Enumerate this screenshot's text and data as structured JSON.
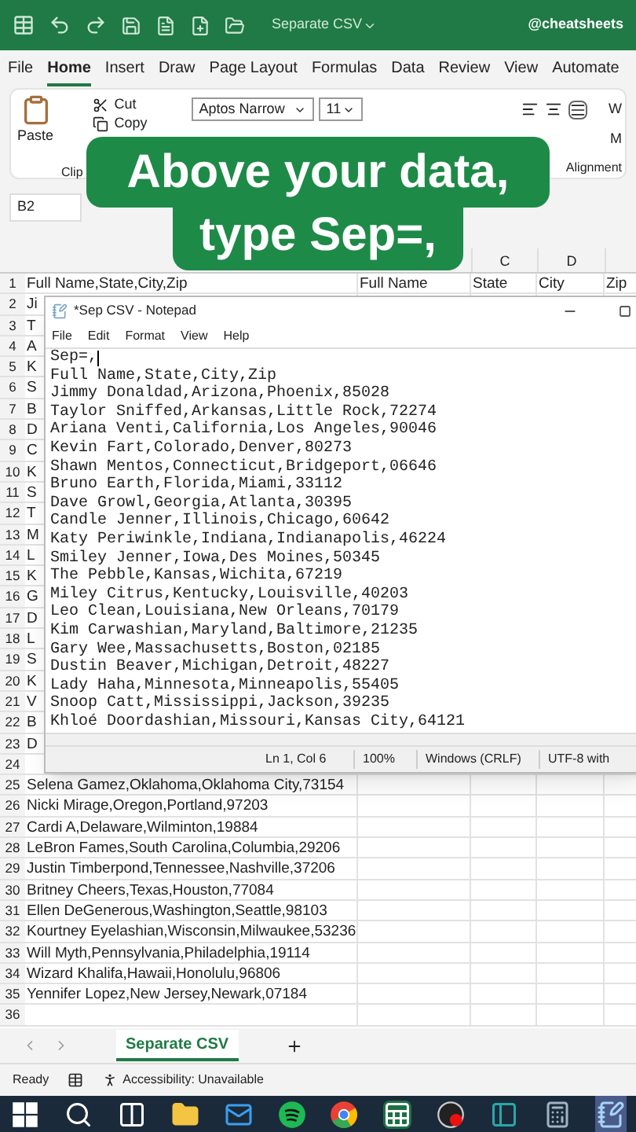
{
  "title_bar": {
    "document": "Separate CSV",
    "account": "@cheatsheets"
  },
  "ribbon_tabs": [
    {
      "label": "File",
      "selected": false
    },
    {
      "label": "Home",
      "selected": true
    },
    {
      "label": "Insert",
      "selected": false
    },
    {
      "label": "Draw",
      "selected": false
    },
    {
      "label": "Page Layout",
      "selected": false
    },
    {
      "label": "Formulas",
      "selected": false
    },
    {
      "label": "Data",
      "selected": false
    },
    {
      "label": "Review",
      "selected": false
    },
    {
      "label": "View",
      "selected": false
    },
    {
      "label": "Automate",
      "selected": false
    }
  ],
  "ribbon": {
    "paste": "Paste",
    "cut": "Cut",
    "copy": "Copy",
    "clipboard_group": "Clip",
    "font": "Aptos Narrow",
    "font_size": "11",
    "alignment_group": "Alignment",
    "wrap": "W",
    "merge": "M"
  },
  "caption": [
    "Above your data,",
    "type Sep=,"
  ],
  "name_box": "B2",
  "column_headers": [
    {
      "label": "C"
    },
    {
      "label": "D"
    }
  ],
  "rows": [
    {
      "number": "1",
      "cells": [
        "Full Name,State,City,Zip",
        "Full Name",
        "State",
        "City",
        "Zip"
      ]
    },
    {
      "number": "2",
      "cells": [
        "Ji"
      ]
    },
    {
      "number": "3",
      "cells": [
        "T"
      ]
    },
    {
      "number": "4",
      "cells": [
        "A"
      ]
    },
    {
      "number": "5",
      "cells": [
        "K"
      ]
    },
    {
      "number": "6",
      "cells": [
        "S"
      ]
    },
    {
      "number": "7",
      "cells": [
        "B"
      ]
    },
    {
      "number": "8",
      "cells": [
        "D"
      ]
    },
    {
      "number": "9",
      "cells": [
        "C"
      ]
    },
    {
      "number": "10",
      "cells": [
        "K"
      ]
    },
    {
      "number": "11",
      "cells": [
        "S"
      ]
    },
    {
      "number": "12",
      "cells": [
        "T"
      ]
    },
    {
      "number": "13",
      "cells": [
        "M"
      ]
    },
    {
      "number": "14",
      "cells": [
        "L"
      ]
    },
    {
      "number": "15",
      "cells": [
        "K"
      ]
    },
    {
      "number": "16",
      "cells": [
        "G"
      ]
    },
    {
      "number": "17",
      "cells": [
        "D"
      ]
    },
    {
      "number": "18",
      "cells": [
        "L"
      ]
    },
    {
      "number": "19",
      "cells": [
        "S"
      ]
    },
    {
      "number": "20",
      "cells": [
        "K"
      ]
    },
    {
      "number": "21",
      "cells": [
        "V"
      ]
    },
    {
      "number": "22",
      "cells": [
        "B"
      ]
    },
    {
      "number": "23",
      "cells": [
        "D"
      ]
    },
    {
      "number": "24",
      "cells": []
    },
    {
      "number": "25",
      "cells": [
        "Selena Gamez,Oklahoma,Oklahoma City,73154"
      ]
    },
    {
      "number": "26",
      "cells": [
        "Nicki Mirage,Oregon,Portland,97203"
      ]
    },
    {
      "number": "27",
      "cells": [
        "Cardi A,Delaware,Wilminton,19884"
      ]
    },
    {
      "number": "28",
      "cells": [
        "LeBron Fames,South Carolina,Columbia,29206"
      ]
    },
    {
      "number": "29",
      "cells": [
        "Justin Timberpond,Tennessee,Nashville,37206"
      ]
    },
    {
      "number": "30",
      "cells": [
        "Britney Cheers,Texas,Houston,77084"
      ]
    },
    {
      "number": "31",
      "cells": [
        "Ellen DeGenerous,Washington,Seattle,98103"
      ]
    },
    {
      "number": "32",
      "cells": [
        "Kourtney Eyelashian,Wisconsin,Milwaukee,53236"
      ]
    },
    {
      "number": "33",
      "cells": [
        "Will Myth,Pennsylvania,Philadelphia,19114"
      ]
    },
    {
      "number": "34",
      "cells": [
        "Wizard Khalifa,Hawaii,Honolulu,96806"
      ]
    },
    {
      "number": "35",
      "cells": [
        "Yennifer Lopez,New Jersey,Newark,07184"
      ]
    },
    {
      "number": "36",
      "cells": []
    }
  ],
  "notepad": {
    "title": "*Sep CSV - Notepad",
    "menu": [
      "File",
      "Edit",
      "Format",
      "View",
      "Help"
    ],
    "lines": [
      "Sep=,",
      "Full Name,State,City,Zip",
      "Jimmy Donaldad,Arizona,Phoenix,85028",
      "Taylor Sniffed,Arkansas,Little Rock,72274",
      "Ariana Venti,California,Los Angeles,90046",
      "Kevin Fart,Colorado,Denver,80273",
      "Shawn Mentos,Connecticut,Bridgeport,06646",
      "Bruno Earth,Florida,Miami,33112",
      "Dave Growl,Georgia,Atlanta,30395",
      "Candle Jenner,Illinois,Chicago,60642",
      "Katy Periwinkle,Indiana,Indianapolis,46224",
      "Smiley Jenner,Iowa,Des Moines,50345",
      "The Pebble,Kansas,Wichita,67219",
      "Miley Citrus,Kentucky,Louisville,40203",
      "Leo Clean,Louisiana,New Orleans,70179",
      "Kim Carwashian,Maryland,Baltimore,21235",
      "Gary Wee,Massachusetts,Boston,02185",
      "Dustin Beaver,Michigan,Detroit,48227",
      "Lady Haha,Minnesota,Minneapolis,55405",
      "Snoop Catt,Mississippi,Jackson,39235",
      "Khloé Doordashian,Missouri,Kansas City,64121"
    ],
    "status": [
      "Ln 1, Col 6",
      "100%",
      "Windows (CRLF)",
      "UTF-8 with"
    ]
  },
  "sheet_tabs": [
    {
      "label": "Separate CSV",
      "selected": true
    }
  ],
  "status_bar": {
    "mode": "Ready",
    "accessibility": "Accessibility: Unavailable"
  },
  "taskbar": [
    {
      "kind": "start",
      "active": false
    },
    {
      "kind": "search",
      "active": false
    },
    {
      "kind": "taskview",
      "active": false
    },
    {
      "kind": "folder",
      "active": false
    },
    {
      "kind": "mail",
      "active": false
    },
    {
      "kind": "music",
      "active": false
    },
    {
      "kind": "browser",
      "active": false
    },
    {
      "kind": "sheet",
      "active": false
    },
    {
      "kind": "media",
      "active": false
    },
    {
      "kind": "panel",
      "active": false
    },
    {
      "kind": "calculator",
      "active": false
    },
    {
      "kind": "notepad",
      "active": true
    }
  ]
}
